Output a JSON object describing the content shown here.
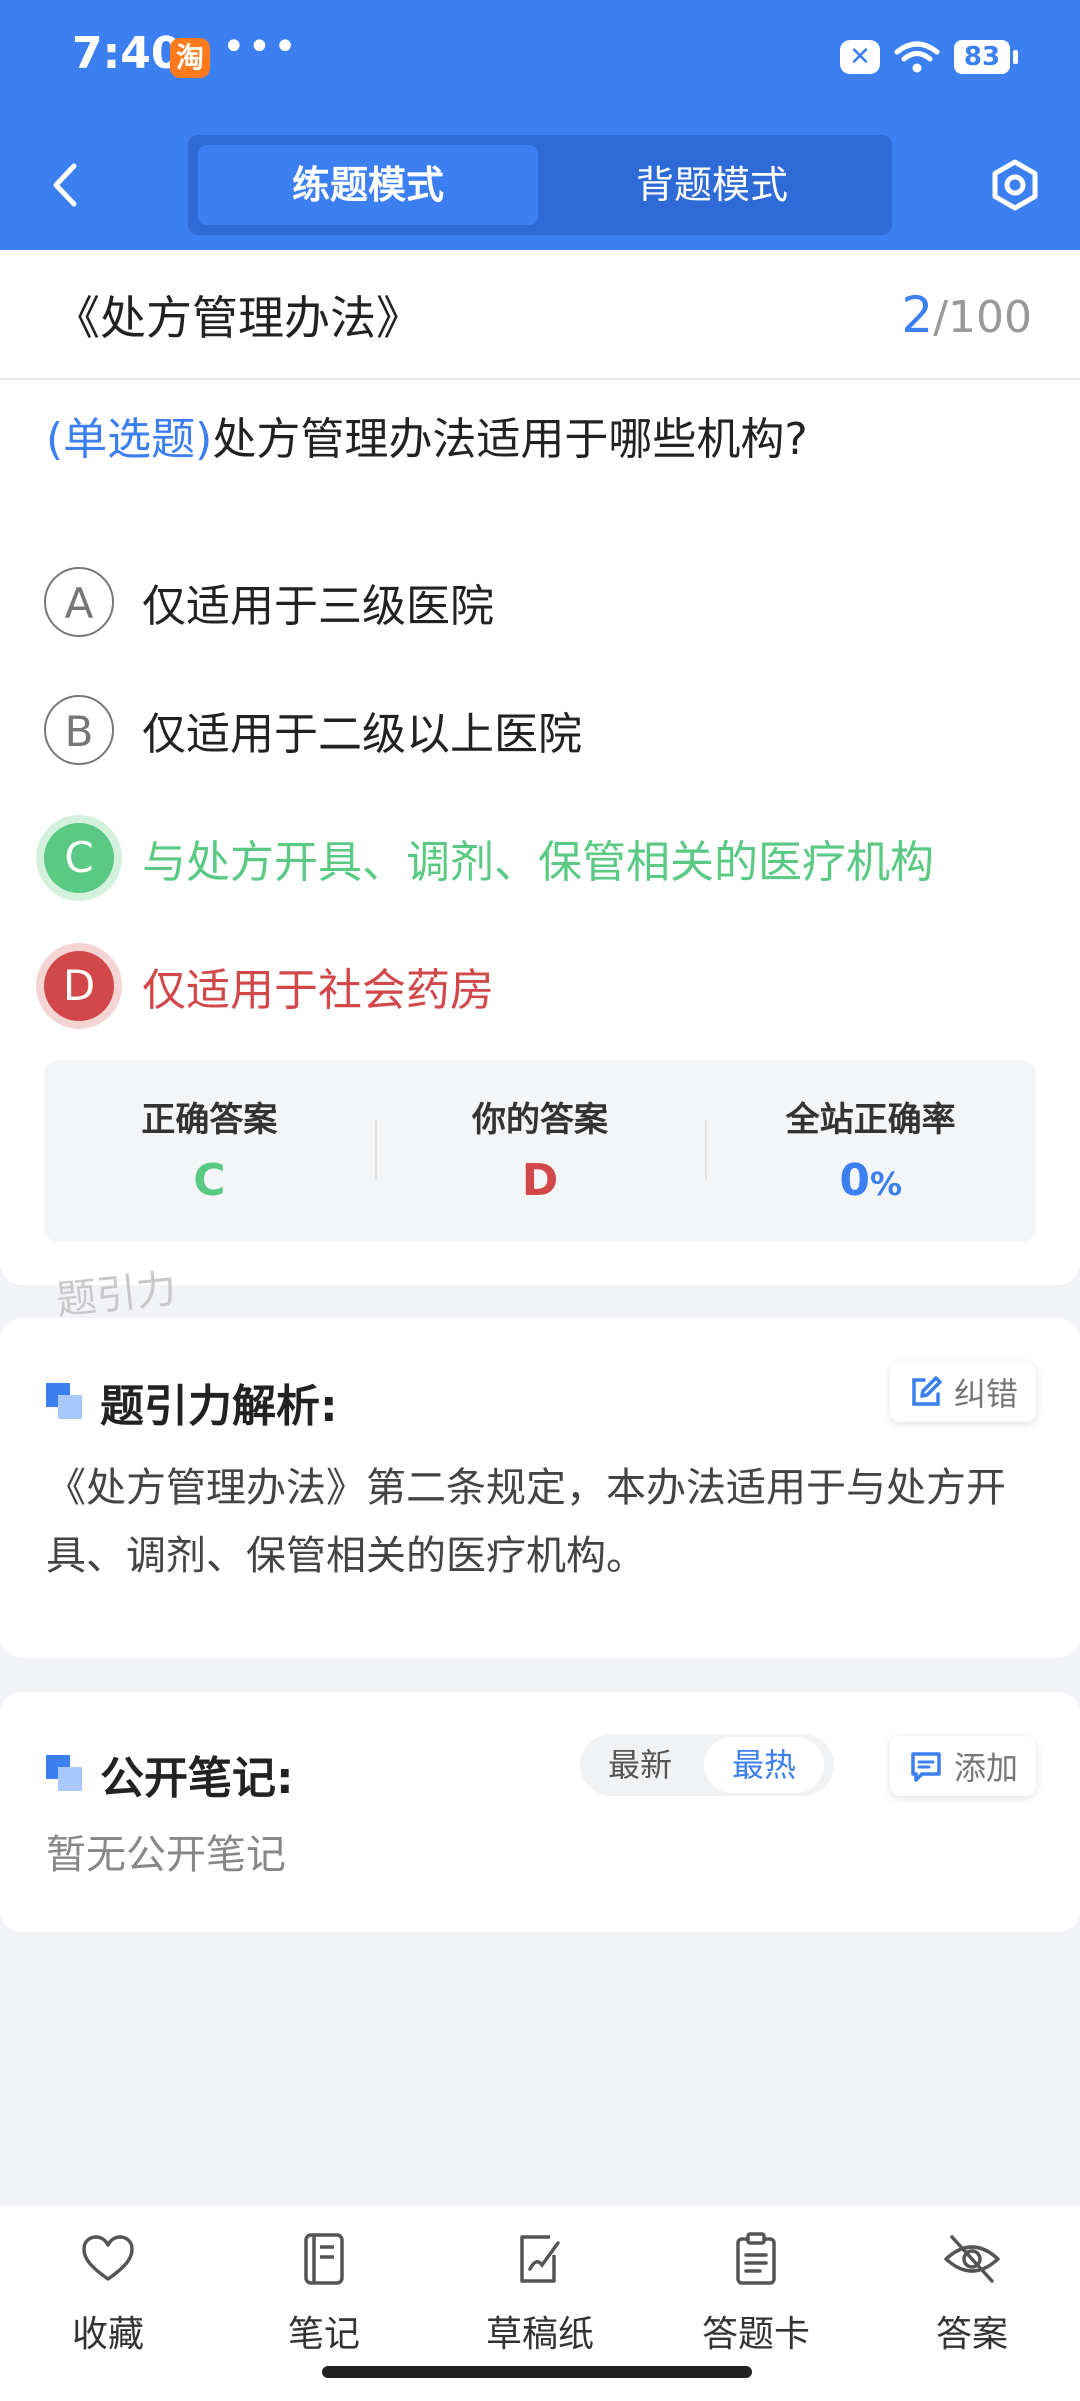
{
  "status_bar": {
    "time": "7:40",
    "app_badge": "淘",
    "more": "•••",
    "battery": "83"
  },
  "header": {
    "tabs": [
      "练题模式",
      "背题模式"
    ],
    "active_tab": 0
  },
  "question": {
    "book_title": "《处方管理办法》",
    "current": "2",
    "total": "/100",
    "type": "(单选题)",
    "text": "处方管理办法适用于哪些机构?",
    "options": [
      {
        "letter": "A",
        "text": "仅适用于三级医院",
        "state": "normal"
      },
      {
        "letter": "B",
        "text": "仅适用于二级以上医院",
        "state": "normal"
      },
      {
        "letter": "C",
        "text": "与处方开具、调剂、保管相关的医疗机构",
        "state": "correct"
      },
      {
        "letter": "D",
        "text": "仅适用于社会药房",
        "state": "wrong"
      }
    ]
  },
  "answers": {
    "correct_label": "正确答案",
    "correct_value": "C",
    "mine_label": "你的答案",
    "mine_value": "D",
    "rate_label": "全站正确率",
    "rate_value": "0",
    "rate_unit": "%"
  },
  "watermark": "题引力",
  "analysis": {
    "title": "题引力解析:",
    "correction_button": "纠错",
    "text": "《处方管理办法》第二条规定，本办法适用于与处方开具、调剂、保管相关的医疗机构。"
  },
  "notes": {
    "title": "公开笔记:",
    "sort_options": [
      "最新",
      "最热"
    ],
    "active_sort": 1,
    "add_button": "添加",
    "empty_text": "暂无公开笔记"
  },
  "bottom_bar": {
    "items": [
      {
        "label": "收藏",
        "icon": "heart-icon"
      },
      {
        "label": "笔记",
        "icon": "notebook-icon"
      },
      {
        "label": "草稿纸",
        "icon": "draft-paper-icon"
      },
      {
        "label": "答题卡",
        "icon": "answer-sheet-icon"
      },
      {
        "label": "答案",
        "icon": "eye-off-icon"
      }
    ]
  },
  "colors": {
    "primary": "#3b7ff0",
    "correct": "#5ac983",
    "wrong": "#d2484a"
  }
}
